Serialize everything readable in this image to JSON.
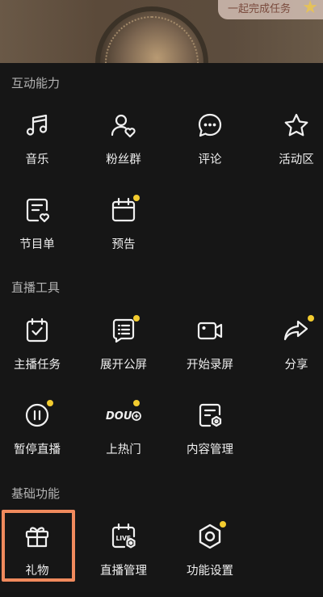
{
  "top": {
    "task_text": "一起完成任务"
  },
  "sections": [
    {
      "title": "互动能力",
      "items": [
        {
          "label": "音乐",
          "icon": "music-note-icon"
        },
        {
          "label": "粉丝群",
          "icon": "fan-group-icon"
        },
        {
          "label": "评论",
          "icon": "comment-bubble-icon"
        },
        {
          "label": "活动区",
          "icon": "star-icon"
        },
        {
          "label": "节目单",
          "icon": "program-list-icon"
        },
        {
          "label": "预告",
          "icon": "calendar-icon",
          "badge": true
        }
      ]
    },
    {
      "title": "直播工具",
      "items": [
        {
          "label": "主播任务",
          "icon": "task-clipboard-icon"
        },
        {
          "label": "展开公屏",
          "icon": "public-screen-icon",
          "badge": true
        },
        {
          "label": "开始录屏",
          "icon": "record-camera-icon"
        },
        {
          "label": "分享",
          "icon": "share-arrow-icon",
          "badge": true
        },
        {
          "label": "暂停直播",
          "icon": "pause-icon",
          "badge": true
        },
        {
          "label": "上热门",
          "icon": "dou-plus-icon",
          "badge": true,
          "icon_text": "DOU"
        },
        {
          "label": "内容管理",
          "icon": "content-manage-icon"
        }
      ]
    },
    {
      "title": "基础功能",
      "items": [
        {
          "label": "礼物",
          "icon": "gift-icon",
          "highlighted": true
        },
        {
          "label": "直播管理",
          "icon": "live-manage-icon",
          "icon_text": "LIVE"
        },
        {
          "label": "功能设置",
          "icon": "settings-hex-icon",
          "badge": true
        }
      ]
    }
  ],
  "colors": {
    "background": "#161616",
    "badge": "#f3cc2f",
    "highlight": "#f08a5d"
  }
}
